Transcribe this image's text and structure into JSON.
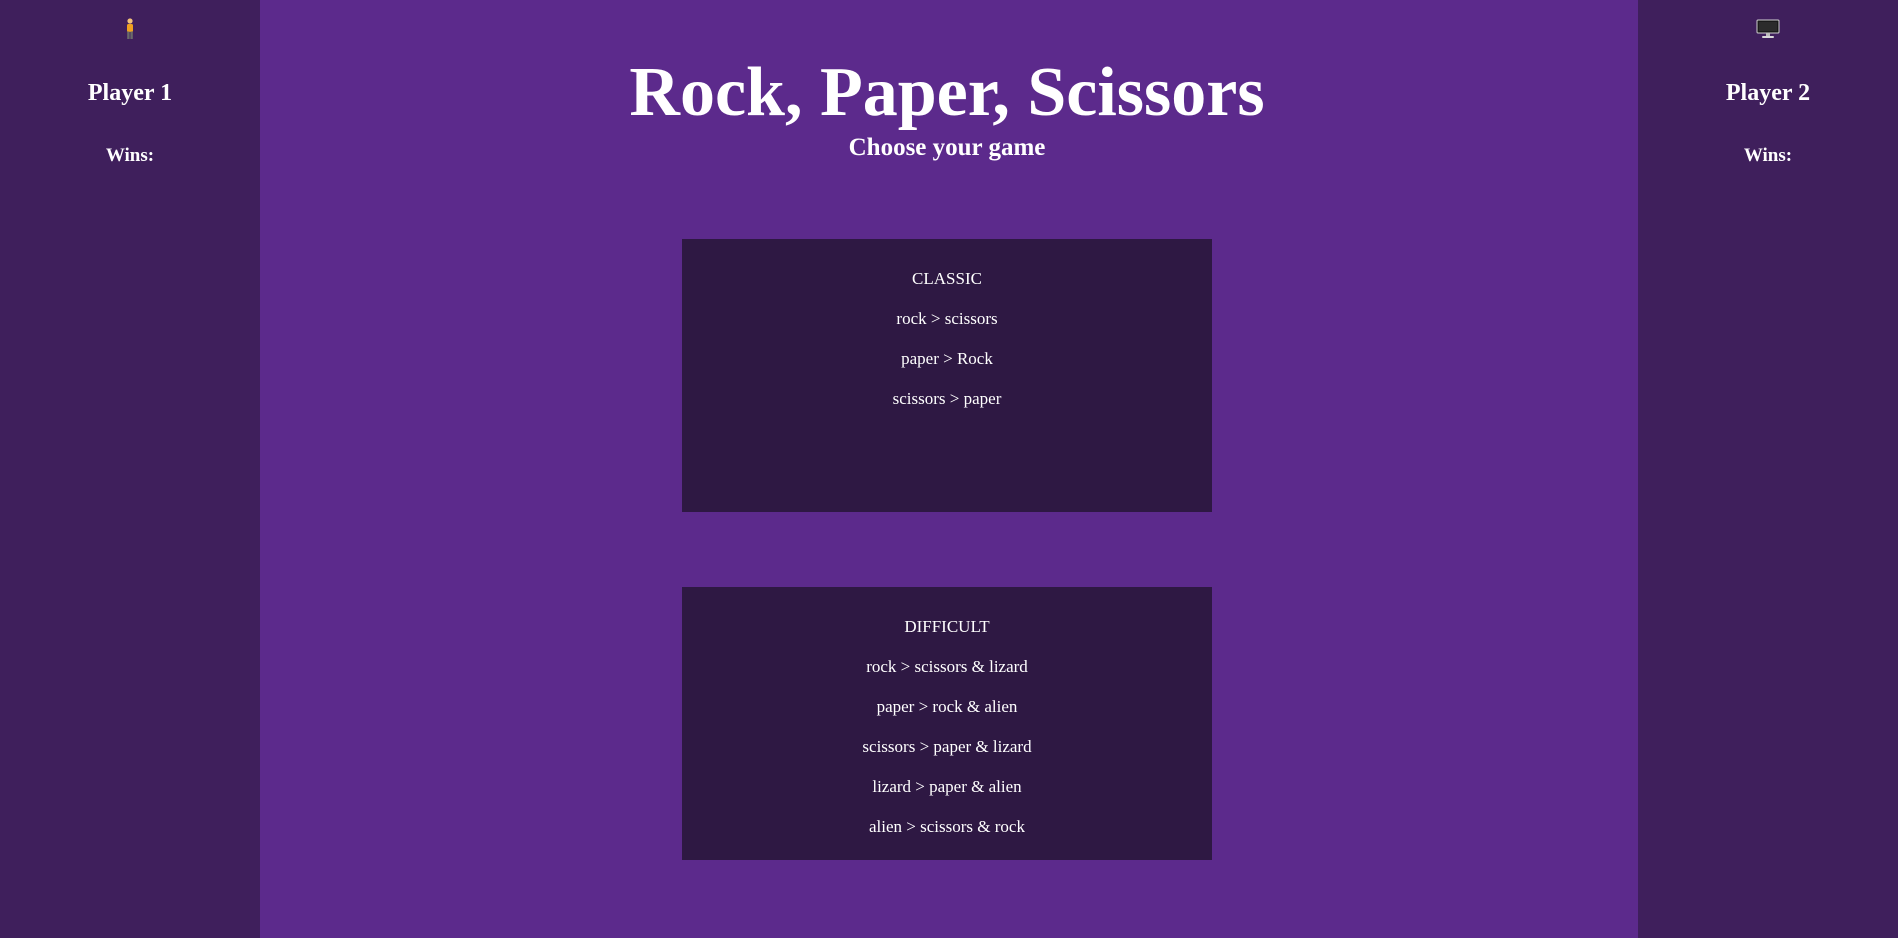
{
  "player1": {
    "icon": "person-icon",
    "name": "Player 1",
    "wins_label": "Wins:"
  },
  "player2": {
    "icon": "computer-icon",
    "name": "Player 2",
    "wins_label": "Wins:"
  },
  "header": {
    "title": "Rock, Paper, Scissors",
    "subtitle": "Choose your game"
  },
  "games": [
    {
      "title": "CLASSIC",
      "rules": [
        "rock > scissors",
        "paper > Rock",
        "scissors > paper"
      ]
    },
    {
      "title": "DIFFICULT",
      "rules": [
        "rock > scissors & lizard",
        "paper > rock & alien",
        "scissors > paper & lizard",
        "lizard > paper & alien",
        "alien > scissors & rock"
      ]
    }
  ],
  "colors": {
    "background": "#5c2a8c",
    "side_panel": "#3f1f5c",
    "card": "#2e1843",
    "text": "#ffffff"
  }
}
